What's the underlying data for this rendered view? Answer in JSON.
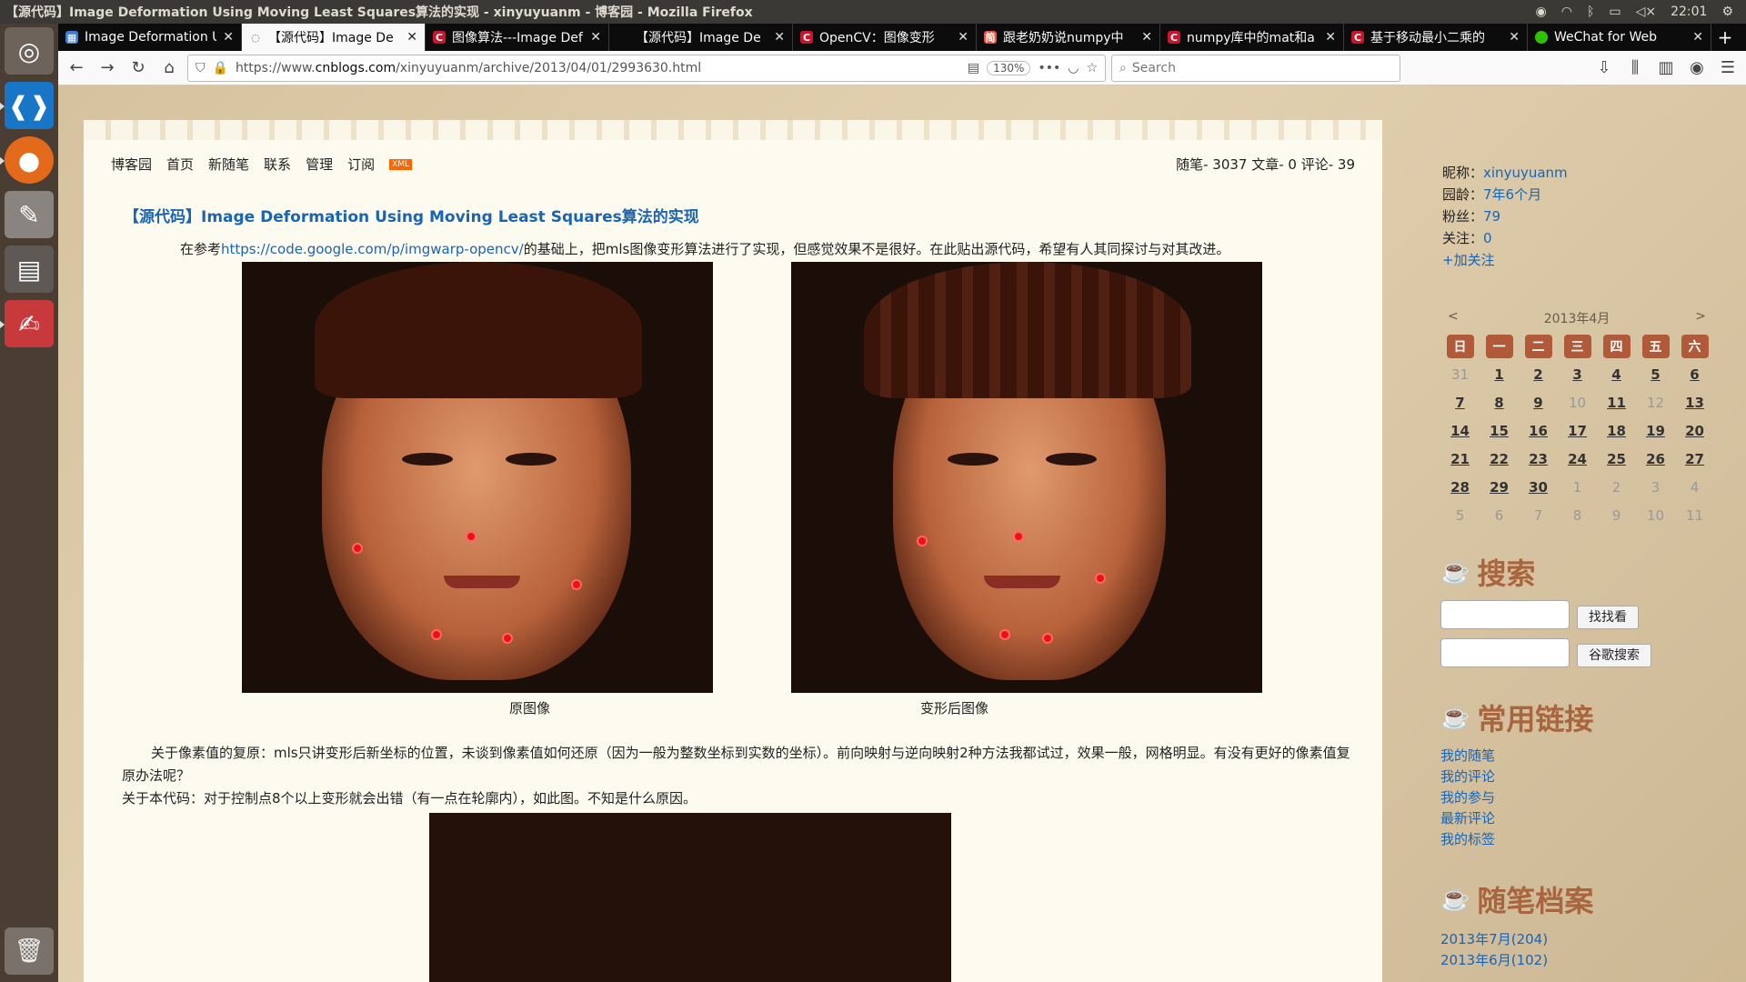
{
  "window": {
    "title": "【源代码】Image Deformation Using Moving Least Squares算法的实现 - xinyuyuanm - 博客园 - Mozilla Firefox",
    "clock": "22:01"
  },
  "tabs": [
    {
      "label": "Image Deformation U",
      "icon": "cnblogs-favicon"
    },
    {
      "label": "【源代码】Image De",
      "icon": "loading-favicon"
    },
    {
      "label": "图像算法---Image Def",
      "icon": "csdn-favicon"
    },
    {
      "label": "【源代码】Image De",
      "icon": "blank-favicon"
    },
    {
      "label": "OpenCV：图像变形",
      "icon": "csdn-favicon"
    },
    {
      "label": "跟老奶奶说numpy中",
      "icon": "jianshu-favicon"
    },
    {
      "label": "numpy库中的mat和a",
      "icon": "csdn-favicon"
    },
    {
      "label": "基于移动最小二乘的",
      "icon": "csdn-favicon"
    },
    {
      "label": "WeChat for Web",
      "icon": "wechat-favicon"
    }
  ],
  "navbar": {
    "url_prefix": "https://www.",
    "url_domain": "cnblogs.com",
    "url_path": "/xinyuyuanm/archive/2013/04/01/2993630.html",
    "zoom": "130%",
    "search_placeholder": "Search"
  },
  "blog": {
    "nav": [
      "博客园",
      "首页",
      "新随笔",
      "联系",
      "管理",
      "订阅"
    ],
    "xml_badge": "XML",
    "stats": "随笔- 3037  文章- 0  评论- 39",
    "post_title": "【源代码】Image Deformation Using Moving Least Squares算法的实现",
    "p1_before": "在参考",
    "p1_link": "https://code.google.com/p/imgwarp-opencv/",
    "p1_after": "的基础上，把mls图像变形算法进行了实现，但感觉效果不是很好。在此贴出源代码，希望有人其同探讨与对其改进。",
    "caption_left": "原图像",
    "caption_right": "变形后图像",
    "p2": "关于像素值的复原：mls只讲变形后新坐标的位置，未谈到像素值如何还原（因为一般为整数坐标到实数的坐标）。前向映射与逆向映射2种方法我都试过，效果一般，网格明显。有没有更好的像素值复原办法呢？",
    "p3": "关于本代码：对于控制点8个以上变形就会出错（有一点在轮廓内），如此图。不知是什么原因。"
  },
  "sidebar": {
    "profile": [
      {
        "label": "昵称：",
        "value": "xinyuyuanm"
      },
      {
        "label": "园龄：",
        "value": "7年6个月"
      },
      {
        "label": "粉丝：",
        "value": "79"
      },
      {
        "label": "关注：",
        "value": "0"
      }
    ],
    "follow": "+加关注",
    "calendar": {
      "prev": "<",
      "next": ">",
      "month": "2013年4月",
      "weekdays": [
        "日",
        "一",
        "二",
        "三",
        "四",
        "五",
        "六"
      ],
      "days": [
        {
          "t": "31",
          "l": false
        },
        {
          "t": "1",
          "l": true
        },
        {
          "t": "2",
          "l": true
        },
        {
          "t": "3",
          "l": true
        },
        {
          "t": "4",
          "l": true
        },
        {
          "t": "5",
          "l": true
        },
        {
          "t": "6",
          "l": true
        },
        {
          "t": "7",
          "l": true
        },
        {
          "t": "8",
          "l": true
        },
        {
          "t": "9",
          "l": true
        },
        {
          "t": "10",
          "l": false
        },
        {
          "t": "11",
          "l": true
        },
        {
          "t": "12",
          "l": false
        },
        {
          "t": "13",
          "l": true
        },
        {
          "t": "14",
          "l": true
        },
        {
          "t": "15",
          "l": true
        },
        {
          "t": "16",
          "l": true
        },
        {
          "t": "17",
          "l": true
        },
        {
          "t": "18",
          "l": true
        },
        {
          "t": "19",
          "l": true
        },
        {
          "t": "20",
          "l": true
        },
        {
          "t": "21",
          "l": true
        },
        {
          "t": "22",
          "l": true
        },
        {
          "t": "23",
          "l": true
        },
        {
          "t": "24",
          "l": true
        },
        {
          "t": "25",
          "l": true
        },
        {
          "t": "26",
          "l": true
        },
        {
          "t": "27",
          "l": true
        },
        {
          "t": "28",
          "l": true
        },
        {
          "t": "29",
          "l": true
        },
        {
          "t": "30",
          "l": true
        },
        {
          "t": "1",
          "l": false
        },
        {
          "t": "2",
          "l": false
        },
        {
          "t": "3",
          "l": false
        },
        {
          "t": "4",
          "l": false
        },
        {
          "t": "5",
          "l": false
        },
        {
          "t": "6",
          "l": false
        },
        {
          "t": "7",
          "l": false
        },
        {
          "t": "8",
          "l": false
        },
        {
          "t": "9",
          "l": false
        },
        {
          "t": "10",
          "l": false
        },
        {
          "t": "11",
          "l": false
        }
      ]
    },
    "search_title": "搜索",
    "search_btn": "找找看",
    "google_btn": "谷歌搜索",
    "links_title": "常用链接",
    "links": [
      "我的随笔",
      "我的评论",
      "我的参与",
      "最新评论",
      "我的标签"
    ],
    "archive_title": "随笔档案",
    "archive": [
      "2013年7月(204)",
      "2013年6月(102)"
    ]
  },
  "colors": {
    "link": "#1a64b4",
    "widget_title": "#a9653d",
    "calendar_header": "#b05a3a",
    "control_point": "#e11111"
  }
}
